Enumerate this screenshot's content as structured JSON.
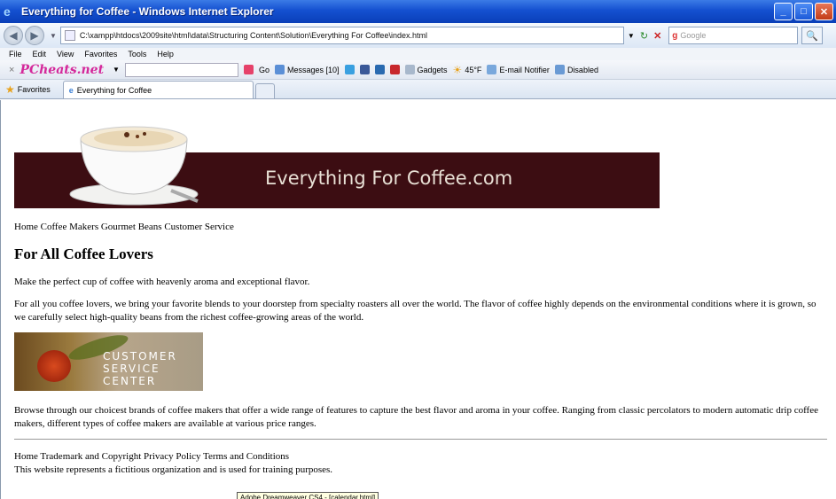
{
  "window": {
    "title": "Everything for Coffee - Windows Internet Explorer",
    "buttons": [
      "_",
      "□",
      "✕"
    ]
  },
  "address": {
    "url": "C:\\xampp\\htdocs\\2009site\\html\\data\\Structuring Content\\Solution\\Everything For Coffee\\index.html",
    "search_placeholder": "Google"
  },
  "menu": [
    "File",
    "Edit",
    "View",
    "Favorites",
    "Tools",
    "Help"
  ],
  "toolbar": {
    "brand": "PCheats.net",
    "go": "Go",
    "messages": "Messages [10]",
    "gadgets": "Gadgets",
    "temperature": "45°F",
    "email": "E-mail Notifier",
    "disabled": "Disabled"
  },
  "favbar": {
    "favorites": "Favorites",
    "tab_title": "Everything for Coffee"
  },
  "page": {
    "banner_title": "Everything For Coffee.com",
    "nav": "Home Coffee Makers Gourmet Beans Customer Service",
    "heading": "For All Coffee Lovers",
    "p1": "Make the perfect cup of coffee with heavenly aroma and exceptional flavor.",
    "p2": "For all you coffee lovers, we bring your favorite blends to your doorstep from specialty roasters all over the world. The flavor of coffee highly depends on the environmental conditions where it is grown, so we carefully select high-quality beans from the richest coffee-growing areas of the world.",
    "csc_lines": [
      "CUSTOMER",
      "SERVICE",
      "CENTER"
    ],
    "p3": "Browse through our choicest brands of coffee makers that offer a wide range of features to capture the best flavor and aroma in your coffee. Ranging from classic percolators to modern automatic drip coffee makers, different types of coffee makers are available at various price ranges.",
    "footer_links": "Home Trademark and Copyright Privacy Policy Terms and Conditions",
    "footer_note": "This website represents a fictitious organization and is used for training purposes."
  },
  "tooltip": "Adobe Dreamweaver CS4 - [calendar.html]"
}
